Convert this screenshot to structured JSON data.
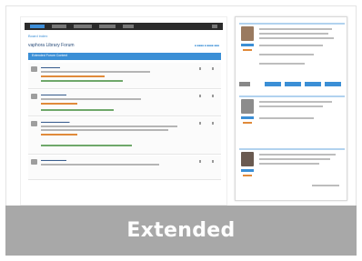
{
  "banner": {
    "label": "Extended"
  },
  "preview": {
    "breadcrumb": "Board index",
    "forum_title": "vaphora Library Forum",
    "category_header": "Extended Forum Content",
    "accent_color": "#3b8fd6",
    "banner_color": "#a8a8a8"
  }
}
